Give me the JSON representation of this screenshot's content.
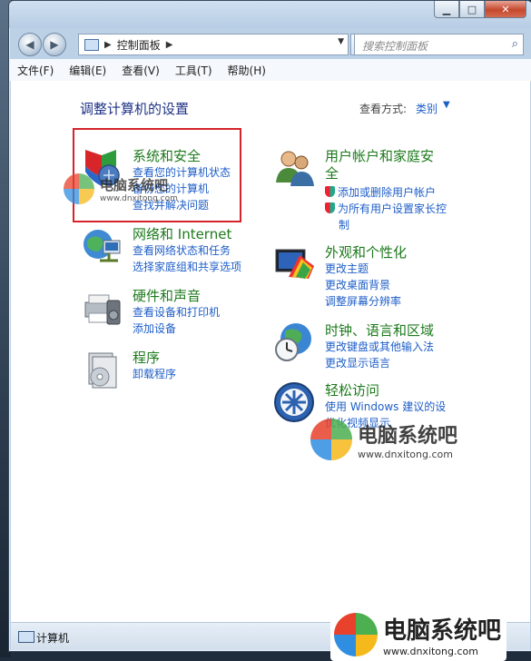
{
  "window": {
    "caption_buttons": {
      "minimize": "▁",
      "maximize": "□",
      "close": "✕"
    }
  },
  "nav": {
    "back_icon": "◀",
    "forward_icon": "▶",
    "address_path": "控制面板",
    "search_placeholder": "搜索控制面板",
    "refresh_icon": "⟳",
    "search_icon": "⌕"
  },
  "menubar": [
    "文件(F)",
    "编辑(E)",
    "查看(V)",
    "工具(T)",
    "帮助(H)"
  ],
  "page": {
    "heading": "调整计算机的设置",
    "view_by_label": "查看方式:",
    "view_by_value": "类别"
  },
  "categories": {
    "system_security": {
      "title": "系统和安全",
      "links": [
        "查看您的计算机状态",
        "备份您的计算机",
        "查找并解决问题"
      ]
    },
    "network": {
      "title": "网络和 Internet",
      "links": [
        "查看网络状态和任务",
        "选择家庭组和共享选项"
      ]
    },
    "hardware": {
      "title": "硬件和声音",
      "links": [
        "查看设备和打印机",
        "添加设备"
      ]
    },
    "programs": {
      "title": "程序",
      "links": [
        "卸载程序"
      ]
    },
    "user_accounts": {
      "title_line1": "用户帐户和家庭安",
      "title_line2": "全",
      "links": [
        "添加或删除用户帐户",
        "为所有用户设置家长控",
        "制"
      ]
    },
    "appearance": {
      "title": "外观和个性化",
      "links": [
        "更改主题",
        "更改桌面背景",
        "调整屏幕分辨率"
      ]
    },
    "clock": {
      "title": "时钟、语言和区域",
      "links": [
        "更改键盘或其他输入法",
        "更改显示语言"
      ]
    },
    "ease": {
      "title": "轻松访问",
      "links": [
        "使用 Windows 建议的设",
        "优化视频显示"
      ]
    }
  },
  "watermark": {
    "name": "电脑系统吧",
    "url": "www.dnxitong.com"
  },
  "statusbar": {
    "text": "计算机"
  },
  "colors": {
    "category_title": "#1c7a1c",
    "link": "#1e5ec8",
    "heading": "#1e3287",
    "highlight_box": "#d6232b"
  }
}
